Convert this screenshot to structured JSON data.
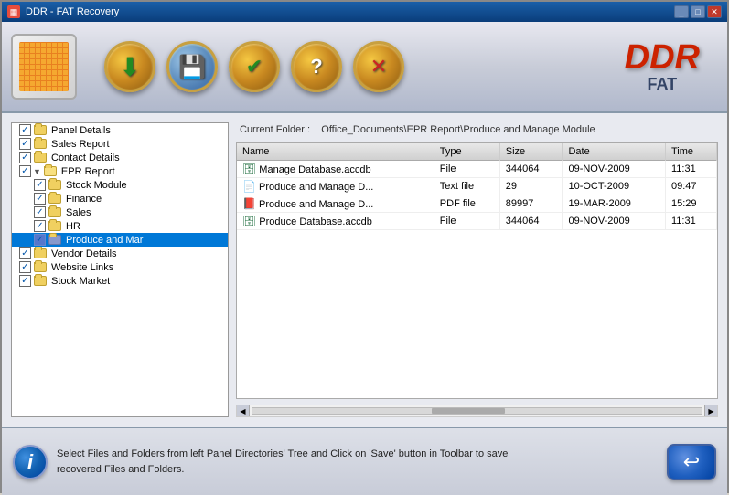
{
  "app": {
    "title": "DDR - FAT Recovery",
    "logo_main": "DDR",
    "logo_sub": "FAT"
  },
  "toolbar": {
    "buttons": [
      {
        "id": "open",
        "symbol": "⬇",
        "color": "#e8a020",
        "title": "Open"
      },
      {
        "id": "save",
        "symbol": "💾",
        "color": "#e8a020",
        "title": "Save"
      },
      {
        "id": "check",
        "symbol": "✔",
        "color": "#e8a020",
        "title": "Check"
      },
      {
        "id": "help",
        "symbol": "?",
        "color": "#e8a020",
        "title": "Help"
      },
      {
        "id": "close",
        "symbol": "✕",
        "color": "#e8a020",
        "title": "Close"
      }
    ]
  },
  "tree": {
    "items": [
      {
        "id": "panel-details",
        "label": "Panel Details",
        "level": 1,
        "checked": true,
        "selected": false
      },
      {
        "id": "sales-report",
        "label": "Sales Report",
        "level": 1,
        "checked": true,
        "selected": false
      },
      {
        "id": "contact-details",
        "label": "Contact Details",
        "level": 1,
        "checked": true,
        "selected": false
      },
      {
        "id": "epr-report",
        "label": "EPR Report",
        "level": 1,
        "checked": true,
        "selected": false,
        "expanded": true
      },
      {
        "id": "stock-module",
        "label": "Stock Module",
        "level": 2,
        "checked": true,
        "selected": false
      },
      {
        "id": "finance",
        "label": "Finance",
        "level": 2,
        "checked": true,
        "selected": false
      },
      {
        "id": "sales",
        "label": "Sales",
        "level": 2,
        "checked": true,
        "selected": false
      },
      {
        "id": "hr",
        "label": "HR",
        "level": 2,
        "checked": true,
        "selected": false
      },
      {
        "id": "produce-and-manage",
        "label": "Produce and Mar",
        "level": 2,
        "checked": true,
        "selected": true
      },
      {
        "id": "vendor-details",
        "label": "Vendor Details",
        "level": 1,
        "checked": true,
        "selected": false
      },
      {
        "id": "website-links",
        "label": "Website Links",
        "level": 1,
        "checked": true,
        "selected": false
      },
      {
        "id": "stock-market",
        "label": "Stock Market",
        "level": 1,
        "checked": true,
        "selected": false
      }
    ]
  },
  "file_view": {
    "current_folder_label": "Current Folder :",
    "current_folder_path": "Office_Documents\\EPR Report\\Produce and Manage Module",
    "columns": [
      "Name",
      "Type",
      "Size",
      "Date",
      "Time"
    ],
    "files": [
      {
        "name": "Manage Database.accdb",
        "type": "File",
        "size": "344064",
        "date": "09-NOV-2009",
        "time": "11:31",
        "icon": "db"
      },
      {
        "name": "Produce and Manage D...",
        "type": "Text file",
        "size": "29",
        "date": "10-OCT-2009",
        "time": "09:47",
        "icon": "txt"
      },
      {
        "name": "Produce and Manage D...",
        "type": "PDF file",
        "size": "89997",
        "date": "19-MAR-2009",
        "time": "15:29",
        "icon": "pdf"
      },
      {
        "name": "Produce Database.accdb",
        "type": "File",
        "size": "344064",
        "date": "09-NOV-2009",
        "time": "11:31",
        "icon": "db"
      }
    ]
  },
  "status": {
    "message_line1": "Select Files and Folders from left Panel Directories' Tree and Click on 'Save' button in Toolbar to save",
    "message_line2": "recovered Files and Folders."
  }
}
